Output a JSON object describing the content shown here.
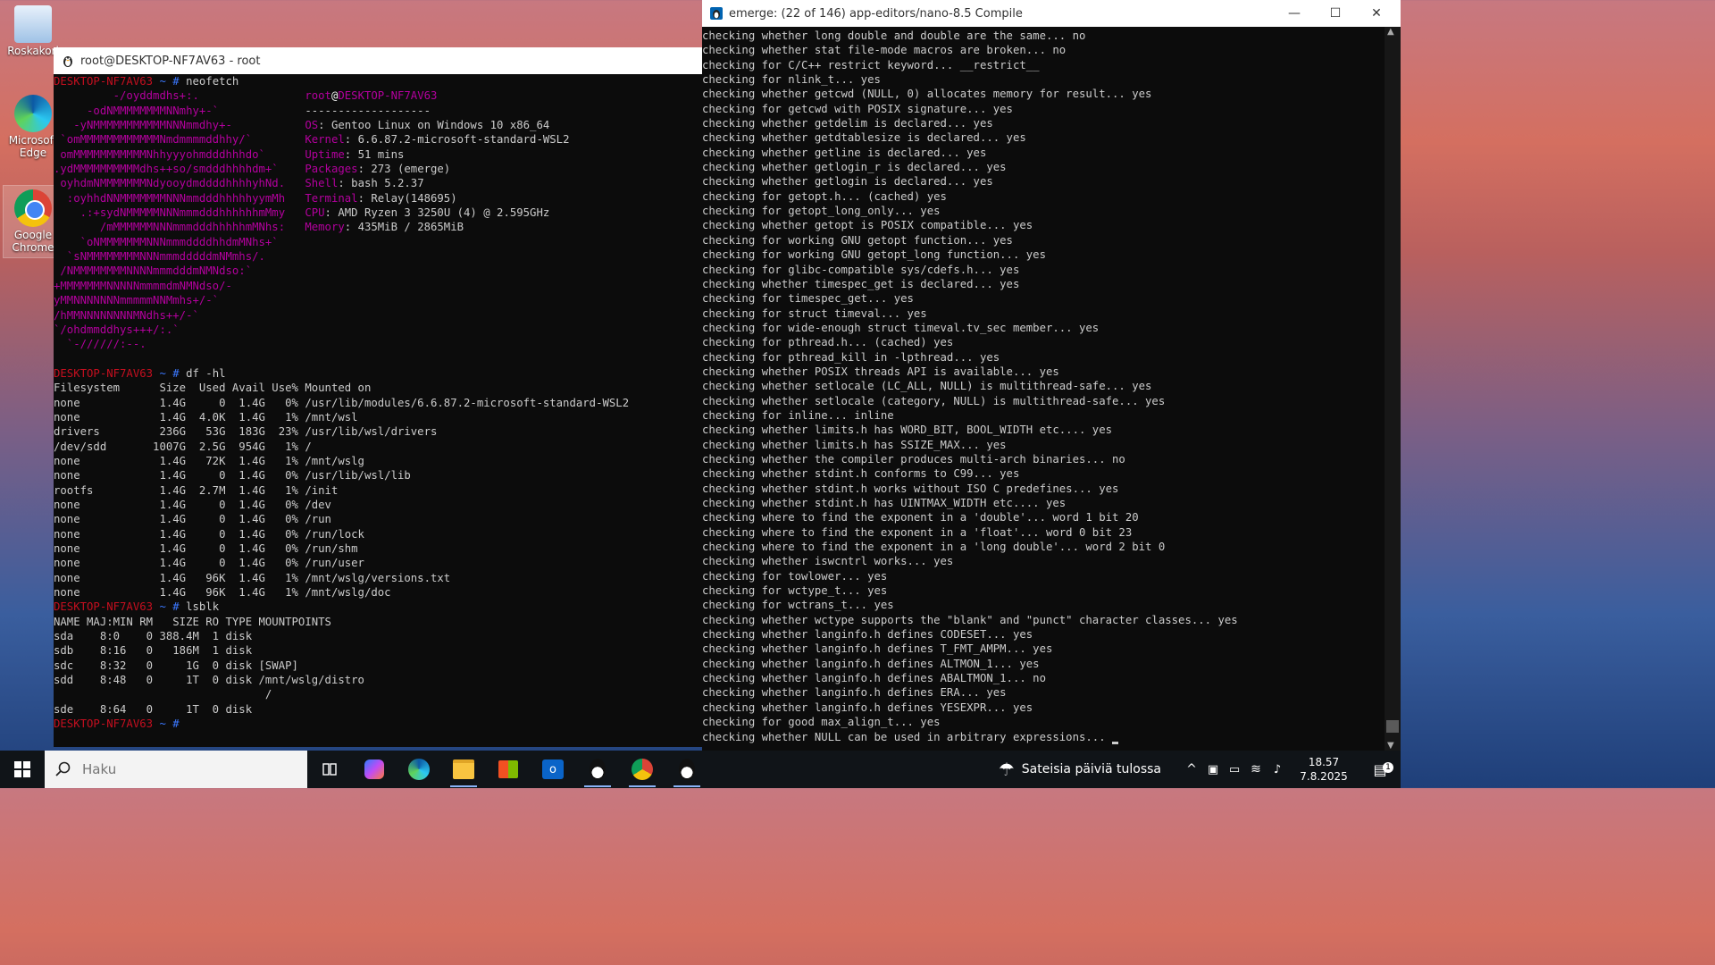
{
  "desktop": {
    "icons": [
      {
        "label": "Roskakori"
      },
      {
        "label": "Microsoft Edge"
      },
      {
        "label": "Google Chrome"
      }
    ]
  },
  "left_window": {
    "title": "root@DESKTOP-NF7AV63 - root"
  },
  "right_window": {
    "title": "emerge: (22 of 146) app-editors/nano-8.5 Compile",
    "minimize": "—",
    "maximize": "☐",
    "close": "✕"
  },
  "neofetch": {
    "prompt_host": "DESKTOP-NF7AV63",
    "prompt_sep": " ~ # ",
    "command": "neofetch",
    "logo": [
      "         -/oyddmdhs+:.",
      "     -odNMMMMMMMMNNmhy+-`",
      "   -yNMMMMMMMMMMMNNNmmdhy+-",
      " `omMMMMMMMMMMMMNmdmmmmddhhy/`",
      " omMMMMMMMMMMMNhhyyyohmdddhhhdo`",
      ".ydMMMMMMMMMMdhs++so/smdddhhhhdm+`",
      " oyhdmNMMMMMMMNdyooydmddddhhhhyhNd.",
      "  :oyhhdNNMMMMMMMNNNmmdddhhhhhyymMh",
      "    .:+sydNMMMMMNNNmmmdddhhhhhhmMmy",
      "       /mMMMMMMNNNmmmdddhhhhhmMNhs:",
      "    `oNMMMMMMMNNNmmmddddhhdmMNhs+`",
      "  `sNMMMMMMMMNNNmmmdddddmNMmhs/.",
      " /NMMMMMMMMNNNNmmmdddmNMNdso:`",
      "+MMMMMMMNNNNNmmmmdmNMNdso/-",
      "yMMNNNNNNNmmmmmNNMmhs+/-`",
      "/hMMNNNNNNNNMNdhs++/-`",
      "`/ohdmmddhys+++/:.`",
      "  `-//////:--."
    ],
    "user_host_user": "root",
    "user_host_at": "@",
    "user_host_host": "DESKTOP-NF7AV63",
    "separator": "-------------------",
    "info": [
      {
        "key": "OS",
        "value": "Gentoo Linux on Windows 10 x86_64"
      },
      {
        "key": "Kernel",
        "value": "6.6.87.2-microsoft-standard-WSL2"
      },
      {
        "key": "Uptime",
        "value": "51 mins"
      },
      {
        "key": "Packages",
        "value": "273 (emerge)"
      },
      {
        "key": "Shell",
        "value": "bash 5.2.37"
      },
      {
        "key": "Terminal",
        "value": "Relay(148695)"
      },
      {
        "key": "CPU",
        "value": "AMD Ryzen 3 3250U (4) @ 2.595GHz"
      },
      {
        "key": "Memory",
        "value": "435MiB / 2865MiB"
      }
    ]
  },
  "df": {
    "command": "df -hl",
    "lines": [
      "Filesystem      Size  Used Avail Use% Mounted on",
      "none            1.4G     0  1.4G   0% /usr/lib/modules/6.6.87.2-microsoft-standard-WSL2",
      "none            1.4G  4.0K  1.4G   1% /mnt/wsl",
      "drivers         236G   53G  183G  23% /usr/lib/wsl/drivers",
      "/dev/sdd       1007G  2.5G  954G   1% /",
      "none            1.4G   72K  1.4G   1% /mnt/wslg",
      "none            1.4G     0  1.4G   0% /usr/lib/wsl/lib",
      "rootfs          1.4G  2.7M  1.4G   1% /init",
      "none            1.4G     0  1.4G   0% /dev",
      "none            1.4G     0  1.4G   0% /run",
      "none            1.4G     0  1.4G   0% /run/lock",
      "none            1.4G     0  1.4G   0% /run/shm",
      "none            1.4G     0  1.4G   0% /run/user",
      "none            1.4G   96K  1.4G   1% /mnt/wslg/versions.txt",
      "none            1.4G   96K  1.4G   1% /mnt/wslg/doc"
    ]
  },
  "lsblk": {
    "command": "lsblk",
    "lines": [
      "NAME MAJ:MIN RM   SIZE RO TYPE MOUNTPOINTS",
      "sda    8:0    0 388.4M  1 disk",
      "sdb    8:16   0   186M  1 disk",
      "sdc    8:32   0     1G  0 disk [SWAP]",
      "sdd    8:48   0     1T  0 disk /mnt/wslg/distro",
      "                                /",
      "sde    8:64   0     1T  0 disk"
    ]
  },
  "compile_log": [
    "checking whether long double and double are the same... no",
    "checking whether stat file-mode macros are broken... no",
    "checking for C/C++ restrict keyword... __restrict__",
    "checking for nlink_t... yes",
    "checking whether getcwd (NULL, 0) allocates memory for result... yes",
    "checking for getcwd with POSIX signature... yes",
    "checking whether getdelim is declared... yes",
    "checking whether getdtablesize is declared... yes",
    "checking whether getline is declared... yes",
    "checking whether getlogin_r is declared... yes",
    "checking whether getlogin is declared... yes",
    "checking for getopt.h... (cached) yes",
    "checking for getopt_long_only... yes",
    "checking whether getopt is POSIX compatible... yes",
    "checking for working GNU getopt function... yes",
    "checking for working GNU getopt_long function... yes",
    "checking for glibc-compatible sys/cdefs.h... yes",
    "checking whether timespec_get is declared... yes",
    "checking for timespec_get... yes",
    "checking for struct timeval... yes",
    "checking for wide-enough struct timeval.tv_sec member... yes",
    "checking for pthread.h... (cached) yes",
    "checking for pthread_kill in -lpthread... yes",
    "checking whether POSIX threads API is available... yes",
    "checking whether setlocale (LC_ALL, NULL) is multithread-safe... yes",
    "checking whether setlocale (category, NULL) is multithread-safe... yes",
    "checking for inline... inline",
    "checking whether limits.h has WORD_BIT, BOOL_WIDTH etc.... yes",
    "checking whether limits.h has SSIZE_MAX... yes",
    "checking whether the compiler produces multi-arch binaries... no",
    "checking whether stdint.h conforms to C99... yes",
    "checking whether stdint.h works without ISO C predefines... yes",
    "checking whether stdint.h has UINTMAX_WIDTH etc.... yes",
    "checking where to find the exponent in a 'double'... word 1 bit 20",
    "checking where to find the exponent in a 'float'... word 0 bit 23",
    "checking where to find the exponent in a 'long double'... word 2 bit 0",
    "checking whether iswcntrl works... yes",
    "checking for towlower... yes",
    "checking for wctype_t... yes",
    "checking for wctrans_t... yes",
    "checking whether wctype supports the \"blank\" and \"punct\" character classes... yes",
    "checking whether langinfo.h defines CODESET... yes",
    "checking whether langinfo.h defines T_FMT_AMPM... yes",
    "checking whether langinfo.h defines ALTMON_1... yes",
    "checking whether langinfo.h defines ABALTMON_1... no",
    "checking whether langinfo.h defines ERA... yes",
    "checking whether langinfo.h defines YESEXPR... yes",
    "checking for good max_align_t... yes",
    "checking whether NULL can be used in arbitrary expressions... "
  ],
  "taskbar": {
    "search_placeholder": "Haku",
    "weather_text": "Sateisia päiviä tulossa",
    "time": "18.57",
    "date": "7.8.2025",
    "notification_count": "1"
  },
  "colors": {
    "prompt_red": "#c50f1f",
    "info_blue": "#3b78ff",
    "logo_magenta": "#b4009e"
  }
}
